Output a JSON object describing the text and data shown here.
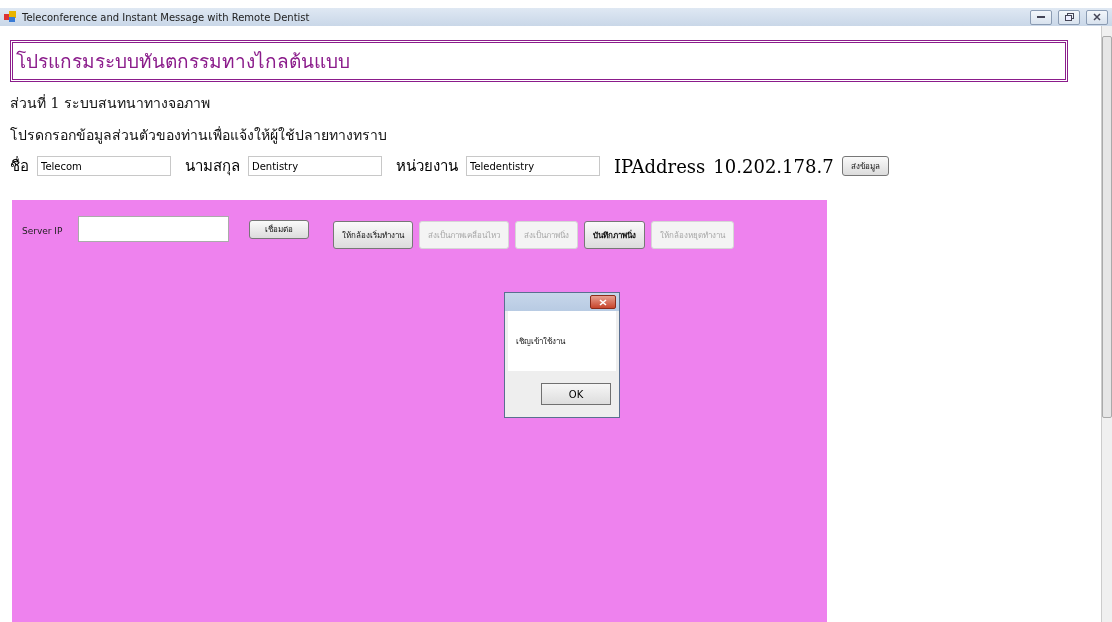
{
  "window": {
    "title": "Teleconference and Instant Message with Remote Dentist"
  },
  "header": {
    "title": "โปรแกรมระบบทันตกรรมทางไกลต้นแบบ"
  },
  "section_title": "ส่วนที่ 1 ระบบสนทนาทางจอภาพ",
  "instruction": "โปรดกรอกข้อมูลส่วนตัวของท่านเพื่อแจ้งให้ผู้ใช้ปลายทางทราบ",
  "fields": [
    {
      "label": "ชื่อ",
      "value": "Telecom"
    },
    {
      "label": "นามสกุล",
      "value": "Dentistry"
    },
    {
      "label": "หน่วยงาน",
      "value": "Teledentistry"
    }
  ],
  "ip_label": "IPAddress",
  "ip_value": "10.202.178.7",
  "send_button": "ส่งข้อมูล",
  "panel": {
    "server_label": "Server IP",
    "connect_button": "เชื่อมต่อ",
    "buttons": [
      {
        "label": "ให้กล้องเริ่มทำงาน",
        "disabled": false
      },
      {
        "label": "ส่งเป็นภาพเคลื่อนไหว",
        "disabled": true
      },
      {
        "label": "ส่งเป็นภาพนิ่ง",
        "disabled": true
      },
      {
        "label": "บันทึกภาพนิ่ง",
        "disabled": false
      },
      {
        "label": "ให้กล้องหยุดทำงาน",
        "disabled": true
      }
    ]
  },
  "dialog": {
    "message": "เชิญเข้าใช้งาน",
    "button": "OK"
  }
}
